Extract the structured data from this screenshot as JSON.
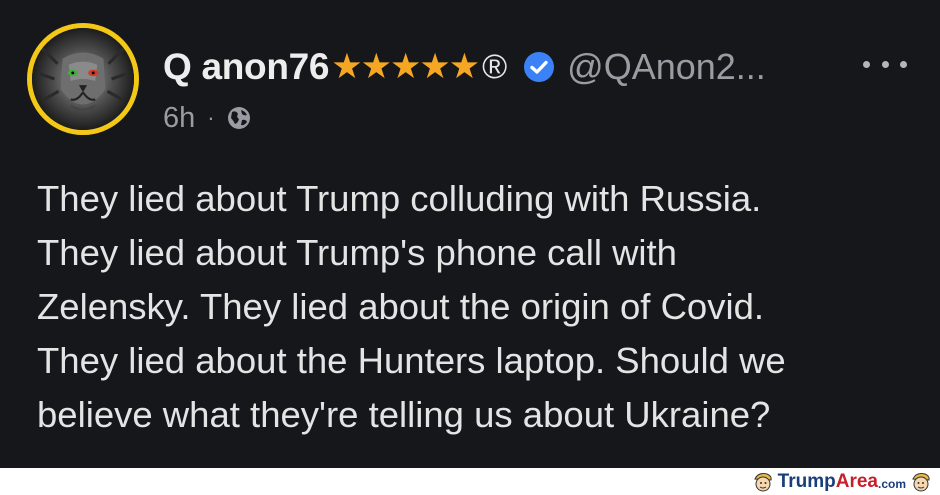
{
  "post": {
    "author": {
      "display_name": "Q anon76",
      "badges": "★★★★★",
      "registered_mark": "®",
      "handle": "@QAnon2...",
      "avatar_icon": "lion-face-icon",
      "avatar_ring_color": "#f3c817",
      "verified_icon": "verified-check-icon",
      "verified_color": "#3b82f6"
    },
    "time": "6h",
    "separator": "·",
    "audience_icon": "globe-icon",
    "more_icon": "more-options-icon",
    "body_lines": [
      "They lied about Trump colluding with Russia.",
      "They lied about Trump's phone call with",
      "Zelensky. They lied about the origin of Covid.",
      "They lied about the Hunters laptop. Should we",
      "believe what they're telling us about Ukraine?"
    ],
    "background_color": "#16171b"
  },
  "watermark": {
    "part1": "Trump",
    "part2": "Area",
    "part3": ".com",
    "icon": "cartoon-face-icon"
  }
}
